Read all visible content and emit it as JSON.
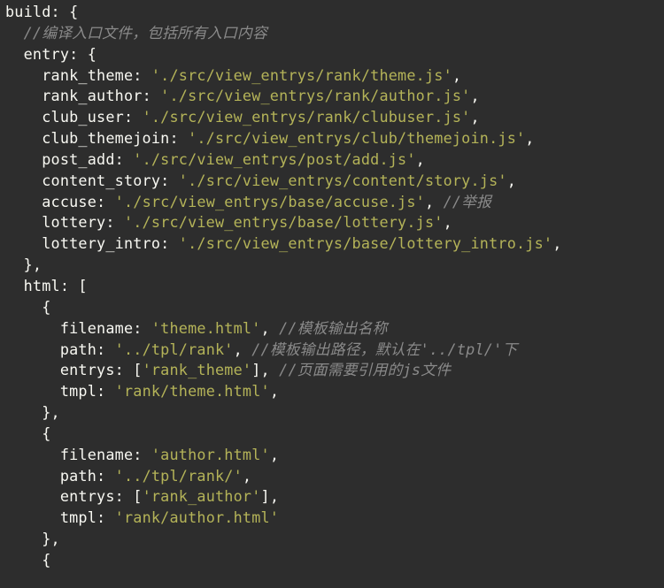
{
  "build_key": "build",
  "entry_comment": "//编译入口文件，包括所有入口内容",
  "entry_key": "entry",
  "entries": {
    "rank_theme": "'./src/view_entrys/rank/theme.js'",
    "rank_author": "'./src/view_entrys/rank/author.js'",
    "club_user": "'./src/view_entrys/rank/clubuser.js'",
    "club_themejoin": "'./src/view_entrys/club/themejoin.js'",
    "post_add": "'./src/view_entrys/post/add.js'",
    "content_story": "'./src/view_entrys/content/story.js'",
    "accuse": "'./src/view_entrys/base/accuse.js'",
    "lottery": "'./src/view_entrys/base/lottery.js'",
    "lottery_intro": "'./src/view_entrys/base/lottery_intro.js'"
  },
  "accuse_comment": "//举报",
  "html_key": "html",
  "html_blocks": [
    {
      "filename_key": "filename",
      "filename_val": "'theme.html'",
      "filename_cmt": "//模板输出名称",
      "path_key": "path",
      "path_val": "'../tpl/rank'",
      "path_cmt_a": "//模板输出路径，默认在",
      "path_cmt_b": "'../tpl/'",
      "path_cmt_c": "下",
      "entrys_key": "entrys",
      "entrys_val": "'rank_theme'",
      "entrys_cmt_a": "//页面需要引用的",
      "entrys_cmt_b": "js",
      "entrys_cmt_c": "文件",
      "tmpl_key": "tmpl",
      "tmpl_val": "'rank/theme.html'",
      "trailing_comma": true
    },
    {
      "filename_key": "filename",
      "filename_val": "'author.html'",
      "path_key": "path",
      "path_val": "'../tpl/rank/'",
      "entrys_key": "entrys",
      "entrys_val": "'rank_author'",
      "tmpl_key": "tmpl",
      "tmpl_val": "'rank/author.html'",
      "trailing_comma": false
    }
  ]
}
